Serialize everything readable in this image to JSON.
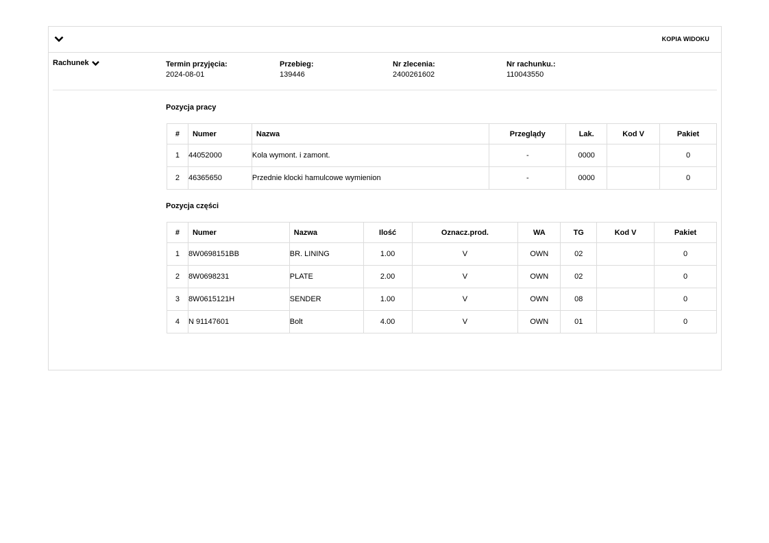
{
  "toolbar": {
    "copy_label": "KOPIA WIDOKU"
  },
  "section": {
    "title": "Rachunek"
  },
  "meta": [
    {
      "label": "Termin przyjęcia:",
      "value": "2024-08-01"
    },
    {
      "label": "Przebieg:",
      "value": "139446"
    },
    {
      "label": "Nr zlecenia:",
      "value": "2400261602"
    },
    {
      "label": "Nr rachunku.:",
      "value": "110043550"
    }
  ],
  "work": {
    "title": "Pozycja pracy",
    "headers": [
      "#",
      "Numer",
      "Nazwa",
      "Przeglądy",
      "Lak.",
      "Kod V",
      "Pakiet"
    ],
    "rows": [
      [
        "1",
        "44052000",
        "Kola wymont. i zamont.",
        "-",
        "0000",
        "",
        "0"
      ],
      [
        "2",
        "46365650",
        "Przednie klocki hamulcowe wymienion",
        "-",
        "0000",
        "",
        "0"
      ]
    ]
  },
  "parts": {
    "title": "Pozycja części",
    "headers": [
      "#",
      "Numer",
      "Nazwa",
      "Ilość",
      "Oznacz.prod.",
      "WA",
      "TG",
      "Kod V",
      "Pakiet"
    ],
    "rows": [
      [
        "1",
        "8W0698151BB",
        "BR. LINING",
        "1.00",
        "V",
        "OWN",
        "02",
        "",
        "0"
      ],
      [
        "2",
        "8W0698231",
        "PLATE",
        "2.00",
        "V",
        "OWN",
        "02",
        "",
        "0"
      ],
      [
        "3",
        "8W0615121H",
        "SENDER",
        "1.00",
        "V",
        "OWN",
        "08",
        "",
        "0"
      ],
      [
        "4",
        "N 91147601",
        "Bolt",
        "4.00",
        "V",
        "OWN",
        "01",
        "",
        "0"
      ]
    ]
  },
  "icons": {
    "collapse": "chevron-down-icon",
    "section_toggle": "chevron-down-icon"
  }
}
